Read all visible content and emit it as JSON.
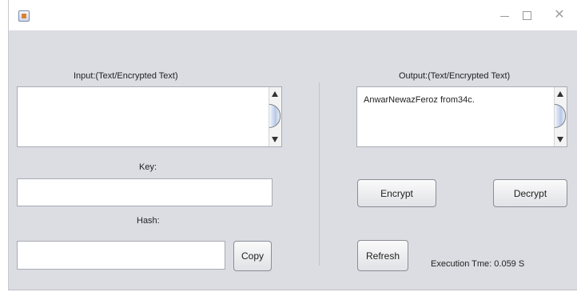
{
  "window": {
    "icon": "java-cup-icon"
  },
  "input": {
    "label": "Input:(Text/Encrypted Text)",
    "value": ""
  },
  "output": {
    "label": "Output:(Text/Encrypted Text)",
    "value": "AnwarNewazFeroz from34c."
  },
  "key": {
    "label": "Key:",
    "value": ""
  },
  "hash": {
    "label": "Hash:",
    "value": ""
  },
  "buttons": {
    "copy": "Copy",
    "encrypt": "Encrypt",
    "decrypt": "Decrypt",
    "refresh": "Refresh"
  },
  "status": {
    "execution_time": "Execution Tme:  0.059 S"
  }
}
